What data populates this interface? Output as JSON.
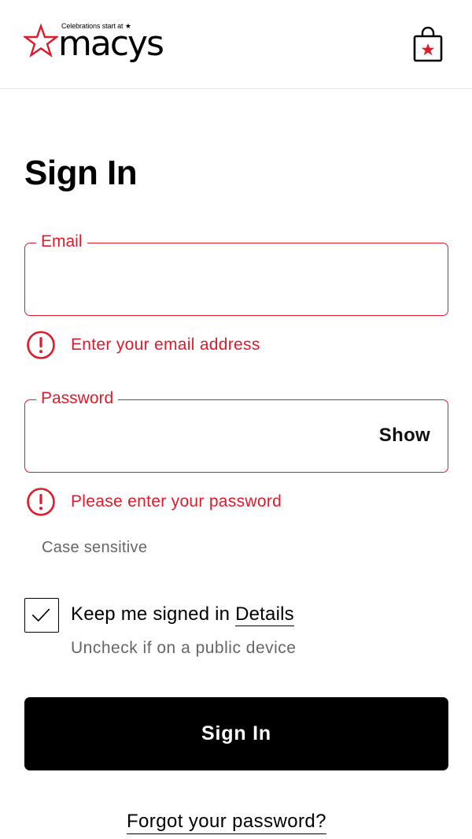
{
  "header": {
    "logo_tagline": "Celebrations start at ★",
    "logo_wordmark": "macys",
    "logo_star_color": "#e01a2b",
    "bag_icon": "shopping-bag-icon"
  },
  "page": {
    "title": "Sign In"
  },
  "email_field": {
    "label": "Email",
    "value": "",
    "error_message": "Enter your email address",
    "error_icon": "alert-circle-icon"
  },
  "password_field": {
    "label": "Password",
    "value": "",
    "show_label": "Show",
    "error_message": "Please enter your password",
    "error_icon": "alert-circle-icon",
    "hint": "Case sensitive"
  },
  "keep_signed_in": {
    "checked": true,
    "label": "Keep me signed in",
    "details_link": "Details",
    "helper": "Uncheck if on a public device"
  },
  "actions": {
    "sign_in_label": "Sign In",
    "forgot_password_label": "Forgot your password?"
  },
  "colors": {
    "error": "#e01a2b",
    "primary_button_bg": "#000000",
    "primary_button_text": "#ffffff"
  }
}
